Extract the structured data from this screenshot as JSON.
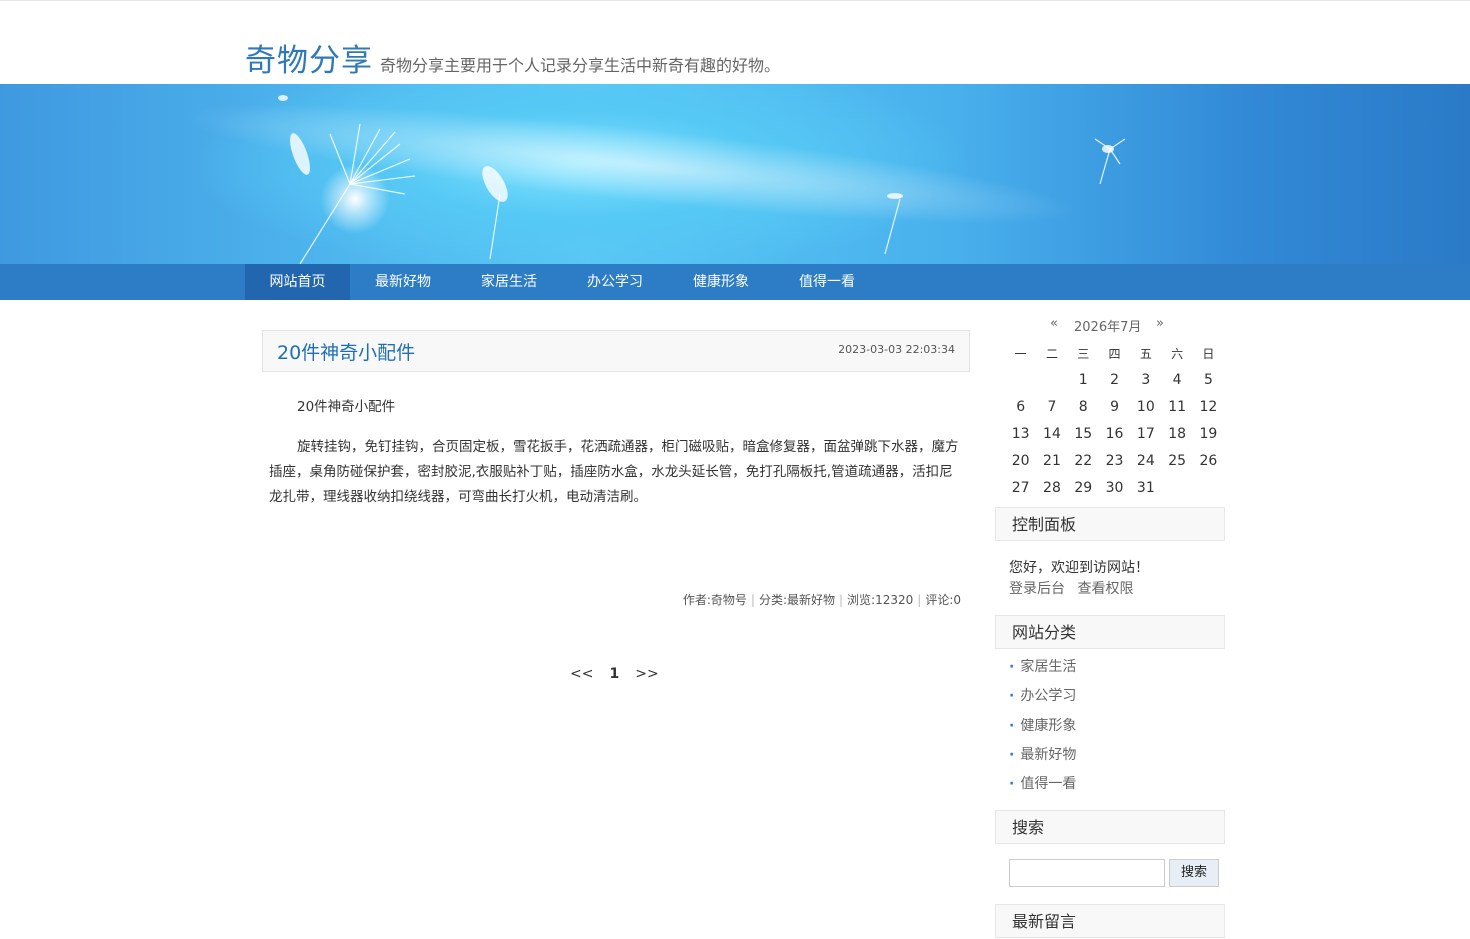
{
  "site": {
    "title": "奇物分享",
    "description": "奇物分享主要用于个人记录分享生活中新奇有趣的好物。"
  },
  "nav": {
    "items": [
      "网站首页",
      "最新好物",
      "家居生活",
      "办公学习",
      "健康形象",
      "值得一看"
    ],
    "active": "网站首页"
  },
  "post": {
    "title": "20件神奇小配件",
    "date": "2023-03-03 22:03:34",
    "paragraphs": [
      "20件神奇小配件",
      "旋转挂钩，免钉挂钩，合页固定板，雪花扳手，花洒疏通器，柜门磁吸贴，暗盒修复器，面盆弹跳下水器，魔方插座，桌角防碰保护套，密封胶泥,衣服贴补丁贴，插座防水盒，水龙头延长管，免打孔隔板托,管道疏通器，活扣尼龙扎带，理线器收纳扣绕线器，可弯曲长打火机，电动清洁刷。"
    ],
    "meta": {
      "author": "作者:奇物号",
      "category": "分类:最新好物",
      "views": "浏览:12320",
      "comments": "评论:0"
    }
  },
  "pager": {
    "prev": "<<",
    "current": "1",
    "next": ">>"
  },
  "calendar": {
    "prev": "«",
    "month": "2026年7月",
    "next": "»",
    "weekdays": [
      "一",
      "二",
      "三",
      "四",
      "五",
      "六",
      "日"
    ],
    "weeks": [
      [
        "",
        "",
        "1",
        "2",
        "3",
        "4",
        "5"
      ],
      [
        "6",
        "7",
        "8",
        "9",
        "10",
        "11",
        "12"
      ],
      [
        "13",
        "14",
        "15",
        "16",
        "17",
        "18",
        "19"
      ],
      [
        "20",
        "21",
        "22",
        "23",
        "24",
        "25",
        "26"
      ],
      [
        "27",
        "28",
        "29",
        "30",
        "31",
        "",
        ""
      ]
    ]
  },
  "control_panel": {
    "title": "控制面板",
    "welcome": "您好，欢迎到访网站！",
    "login": "登录后台",
    "permissions": "查看权限"
  },
  "categories": {
    "title": "网站分类",
    "items": [
      "家居生活",
      "办公学习",
      "健康形象",
      "最新好物",
      "值得一看"
    ]
  },
  "search": {
    "title": "搜索",
    "value": "",
    "button": "搜索"
  },
  "recent_comments": {
    "title": "最新留言"
  }
}
